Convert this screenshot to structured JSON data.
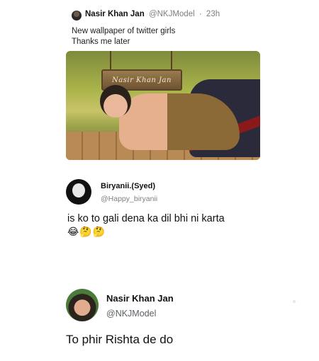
{
  "tweet": {
    "author_name": "Nasir Khan Jan",
    "author_handle": "@NKJModel",
    "time": "23h",
    "text_line1": "New wallpaper of twitter girls",
    "text_line2": "Thanks me later",
    "image_sign_text": "Nasir Khan Jan"
  },
  "quote": {
    "author_name": "Biryanii.(Syed)",
    "author_handle": "@Happy_biryanii",
    "text": "is ko to gali dena ka dil bhi ni karta",
    "emojis": "😂🤔🤔"
  },
  "reply": {
    "author_name": "Nasir Khan Jan",
    "author_handle": "@NKJModel",
    "text": "To phir Rishta de do"
  }
}
